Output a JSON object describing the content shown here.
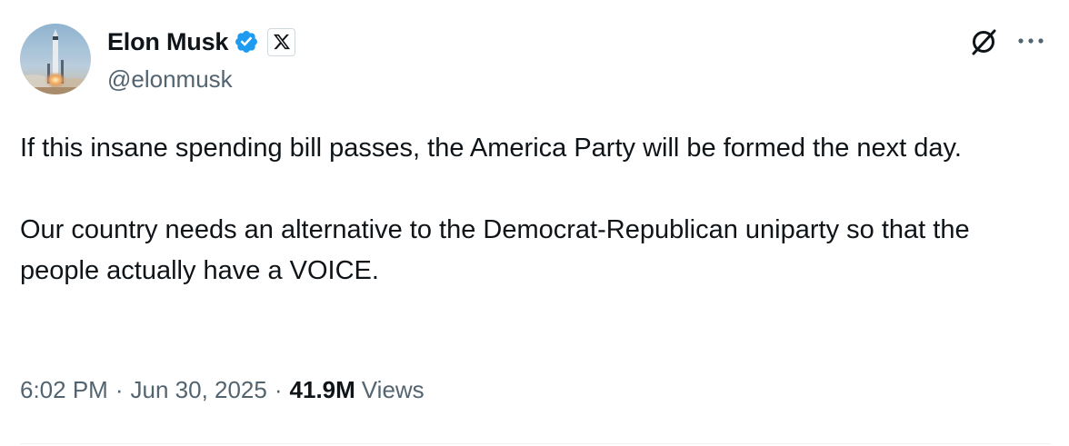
{
  "author": {
    "display_name": "Elon Musk",
    "handle": "@elonmusk",
    "verified": true,
    "affiliation_badge": "x-logo-icon"
  },
  "tweet": {
    "paragraphs": [
      "If this insane spending bill passes, the America Party will be formed the next day.",
      "Our country needs an alternative to the Democrat-Republican uniparty so that the people actually have a VOICE."
    ]
  },
  "meta": {
    "time": "6:02 PM",
    "separator": "·",
    "date": "Jun 30, 2025",
    "views_count": "41.9M",
    "views_label": "Views"
  },
  "icons": {
    "grok": "grok-icon",
    "more": "more-icon",
    "verified": "verified-badge-icon"
  },
  "colors": {
    "text_primary": "#0f1419",
    "text_secondary": "#536471",
    "verified_blue": "#1d9bf0",
    "divider": "#eff3f4"
  }
}
